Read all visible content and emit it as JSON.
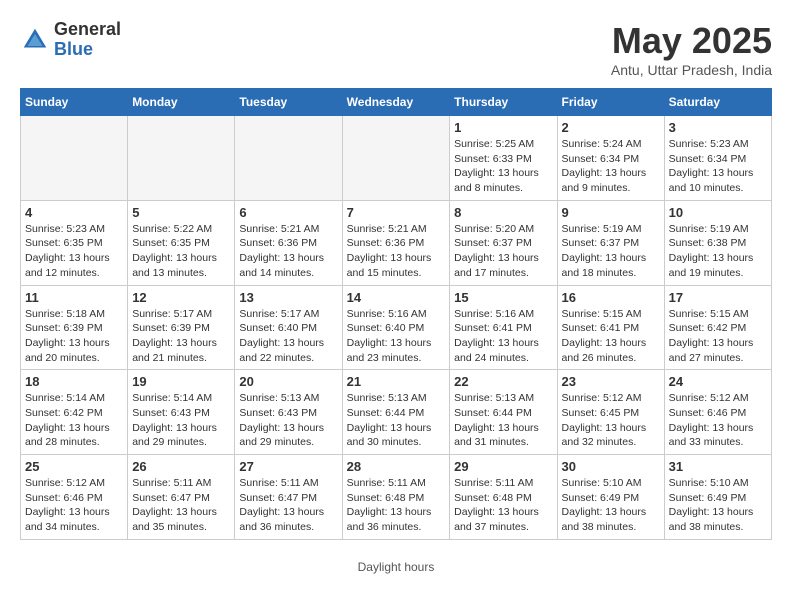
{
  "header": {
    "logo_general": "General",
    "logo_blue": "Blue",
    "month_year": "May 2025",
    "location": "Antu, Uttar Pradesh, India"
  },
  "calendar": {
    "days_of_week": [
      "Sunday",
      "Monday",
      "Tuesday",
      "Wednesday",
      "Thursday",
      "Friday",
      "Saturday"
    ],
    "weeks": [
      [
        {
          "day": "",
          "info": ""
        },
        {
          "day": "",
          "info": ""
        },
        {
          "day": "",
          "info": ""
        },
        {
          "day": "",
          "info": ""
        },
        {
          "day": "1",
          "info": "Sunrise: 5:25 AM\nSunset: 6:33 PM\nDaylight: 13 hours\nand 8 minutes."
        },
        {
          "day": "2",
          "info": "Sunrise: 5:24 AM\nSunset: 6:34 PM\nDaylight: 13 hours\nand 9 minutes."
        },
        {
          "day": "3",
          "info": "Sunrise: 5:23 AM\nSunset: 6:34 PM\nDaylight: 13 hours\nand 10 minutes."
        }
      ],
      [
        {
          "day": "4",
          "info": "Sunrise: 5:23 AM\nSunset: 6:35 PM\nDaylight: 13 hours\nand 12 minutes."
        },
        {
          "day": "5",
          "info": "Sunrise: 5:22 AM\nSunset: 6:35 PM\nDaylight: 13 hours\nand 13 minutes."
        },
        {
          "day": "6",
          "info": "Sunrise: 5:21 AM\nSunset: 6:36 PM\nDaylight: 13 hours\nand 14 minutes."
        },
        {
          "day": "7",
          "info": "Sunrise: 5:21 AM\nSunset: 6:36 PM\nDaylight: 13 hours\nand 15 minutes."
        },
        {
          "day": "8",
          "info": "Sunrise: 5:20 AM\nSunset: 6:37 PM\nDaylight: 13 hours\nand 17 minutes."
        },
        {
          "day": "9",
          "info": "Sunrise: 5:19 AM\nSunset: 6:37 PM\nDaylight: 13 hours\nand 18 minutes."
        },
        {
          "day": "10",
          "info": "Sunrise: 5:19 AM\nSunset: 6:38 PM\nDaylight: 13 hours\nand 19 minutes."
        }
      ],
      [
        {
          "day": "11",
          "info": "Sunrise: 5:18 AM\nSunset: 6:39 PM\nDaylight: 13 hours\nand 20 minutes."
        },
        {
          "day": "12",
          "info": "Sunrise: 5:17 AM\nSunset: 6:39 PM\nDaylight: 13 hours\nand 21 minutes."
        },
        {
          "day": "13",
          "info": "Sunrise: 5:17 AM\nSunset: 6:40 PM\nDaylight: 13 hours\nand 22 minutes."
        },
        {
          "day": "14",
          "info": "Sunrise: 5:16 AM\nSunset: 6:40 PM\nDaylight: 13 hours\nand 23 minutes."
        },
        {
          "day": "15",
          "info": "Sunrise: 5:16 AM\nSunset: 6:41 PM\nDaylight: 13 hours\nand 24 minutes."
        },
        {
          "day": "16",
          "info": "Sunrise: 5:15 AM\nSunset: 6:41 PM\nDaylight: 13 hours\nand 26 minutes."
        },
        {
          "day": "17",
          "info": "Sunrise: 5:15 AM\nSunset: 6:42 PM\nDaylight: 13 hours\nand 27 minutes."
        }
      ],
      [
        {
          "day": "18",
          "info": "Sunrise: 5:14 AM\nSunset: 6:42 PM\nDaylight: 13 hours\nand 28 minutes."
        },
        {
          "day": "19",
          "info": "Sunrise: 5:14 AM\nSunset: 6:43 PM\nDaylight: 13 hours\nand 29 minutes."
        },
        {
          "day": "20",
          "info": "Sunrise: 5:13 AM\nSunset: 6:43 PM\nDaylight: 13 hours\nand 29 minutes."
        },
        {
          "day": "21",
          "info": "Sunrise: 5:13 AM\nSunset: 6:44 PM\nDaylight: 13 hours\nand 30 minutes."
        },
        {
          "day": "22",
          "info": "Sunrise: 5:13 AM\nSunset: 6:44 PM\nDaylight: 13 hours\nand 31 minutes."
        },
        {
          "day": "23",
          "info": "Sunrise: 5:12 AM\nSunset: 6:45 PM\nDaylight: 13 hours\nand 32 minutes."
        },
        {
          "day": "24",
          "info": "Sunrise: 5:12 AM\nSunset: 6:46 PM\nDaylight: 13 hours\nand 33 minutes."
        }
      ],
      [
        {
          "day": "25",
          "info": "Sunrise: 5:12 AM\nSunset: 6:46 PM\nDaylight: 13 hours\nand 34 minutes."
        },
        {
          "day": "26",
          "info": "Sunrise: 5:11 AM\nSunset: 6:47 PM\nDaylight: 13 hours\nand 35 minutes."
        },
        {
          "day": "27",
          "info": "Sunrise: 5:11 AM\nSunset: 6:47 PM\nDaylight: 13 hours\nand 36 minutes."
        },
        {
          "day": "28",
          "info": "Sunrise: 5:11 AM\nSunset: 6:48 PM\nDaylight: 13 hours\nand 36 minutes."
        },
        {
          "day": "29",
          "info": "Sunrise: 5:11 AM\nSunset: 6:48 PM\nDaylight: 13 hours\nand 37 minutes."
        },
        {
          "day": "30",
          "info": "Sunrise: 5:10 AM\nSunset: 6:49 PM\nDaylight: 13 hours\nand 38 minutes."
        },
        {
          "day": "31",
          "info": "Sunrise: 5:10 AM\nSunset: 6:49 PM\nDaylight: 13 hours\nand 38 minutes."
        }
      ]
    ]
  },
  "footer": {
    "daylight_label": "Daylight hours"
  }
}
